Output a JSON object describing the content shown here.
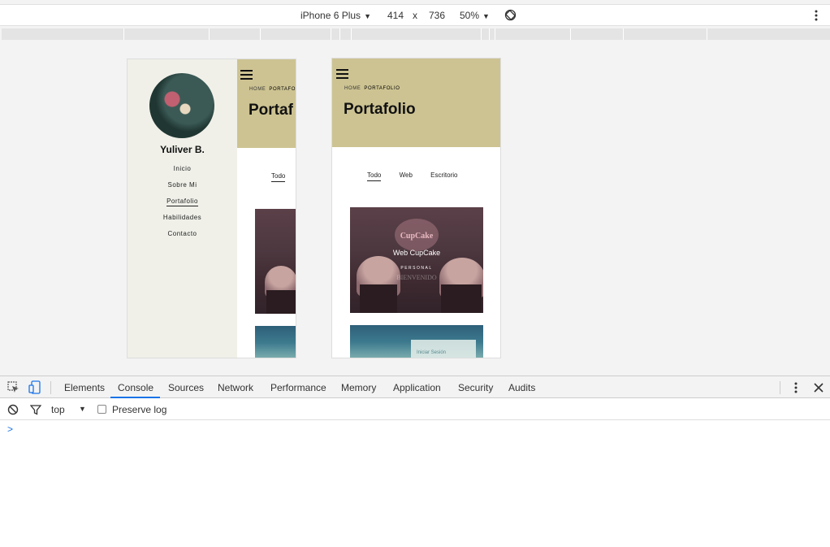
{
  "device_toolbar": {
    "device": "iPhone 6 Plus",
    "width": "414",
    "times": "x",
    "height": "736",
    "zoom": "50%"
  },
  "preview_left": {
    "name": "Yuliver B.",
    "nav": [
      "Inicio",
      "Sobre Mi",
      "Portafolio",
      "Habilidades",
      "Contacto"
    ],
    "crumbs_home": "HOME",
    "crumbs_current": "PORTAFO",
    "title": "Portaf",
    "filter_all": "Todo"
  },
  "preview_right": {
    "crumbs_home": "HOME",
    "crumbs_current": "PORTAFOLIO",
    "title": "Portafolio",
    "filters": [
      "Todo",
      "Web",
      "Escritorio"
    ],
    "item1_title": "Web CupCake",
    "item1_sub": "PERSONAL",
    "item1_logo": "CupCake",
    "item1_faded": "BIENVENIDO",
    "item2_label": "Iniciar Sesión"
  },
  "devtools": {
    "tabs": [
      "Elements",
      "Console",
      "Sources",
      "Network",
      "Performance",
      "Memory",
      "Application",
      "Security",
      "Audits"
    ],
    "active_tab": "Console",
    "context": "top",
    "preserve_log": "Preserve log",
    "prompt": ">"
  }
}
